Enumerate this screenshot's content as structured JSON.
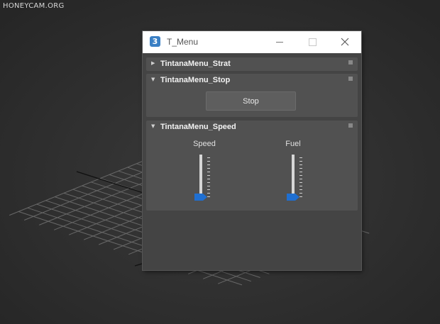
{
  "watermark": "HONEYCAM.ORG",
  "window": {
    "icon_text": "3",
    "title": "T_Menu"
  },
  "rollouts": [
    {
      "title": "TintanaMenu_Strat",
      "expanded": false
    },
    {
      "title": "TintanaMenu_Stop",
      "expanded": true,
      "button_label": "Stop"
    },
    {
      "title": "TintanaMenu_Speed",
      "expanded": true,
      "sliders": [
        {
          "label": "Speed",
          "value": 0
        },
        {
          "label": "Fuel",
          "value": 0
        }
      ]
    }
  ],
  "icons": {
    "collapsed_arrow": "▶",
    "expanded_arrow": "▼"
  },
  "colors": {
    "slider_thumb": "#1f6fd1",
    "window_bg": "#444444",
    "rollout_bg": "#515151"
  }
}
